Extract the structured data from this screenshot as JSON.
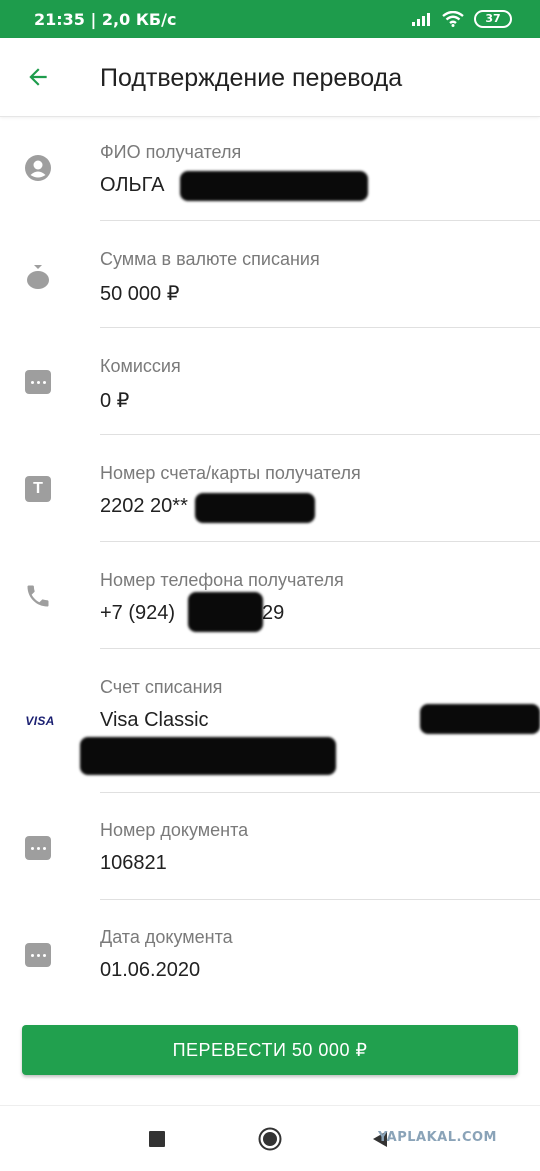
{
  "status_bar": {
    "time_speed": "21:35 | 2,0 КБ/с",
    "battery": "37"
  },
  "header": {
    "title": "Подтверждение перевода",
    "back_icon": "arrow-back-icon"
  },
  "fields": {
    "recipient_name": {
      "label": "ФИО получателя",
      "value": "ОЛЬГА",
      "icon": "person-icon"
    },
    "amount": {
      "label": "Сумма в валюте списания",
      "value": "50 000 ₽",
      "icon": "money-bag-icon"
    },
    "commission": {
      "label": "Комиссия",
      "value": "0 ₽",
      "icon": "dots-icon"
    },
    "account": {
      "label": "Номер счета/карты получателя",
      "value": "2202 20**",
      "icon": "t-icon"
    },
    "phone": {
      "label": "Номер телефона получателя",
      "value_prefix": "+7 (924)",
      "value_suffix": "29",
      "icon": "phone-icon"
    },
    "debit_account": {
      "label": "Счет списания",
      "value": "Visa Classic",
      "icon_text": "VISA",
      "icon": "visa-icon"
    },
    "document_number": {
      "label": "Номер документа",
      "value": "106821",
      "icon": "dots-icon"
    },
    "document_date": {
      "label": "Дата документа",
      "value": "01.06.2020",
      "icon": "dots-icon"
    }
  },
  "actions": {
    "transfer_label": "ПЕРЕВЕСТИ 50 000 ₽"
  },
  "watermark": "YAPLAKAL.COM",
  "colors": {
    "brand_green": "#1e9c4c",
    "button_green": "#21a04e",
    "label_gray": "#7a7a7a",
    "icon_gray": "#9e9e9e"
  }
}
